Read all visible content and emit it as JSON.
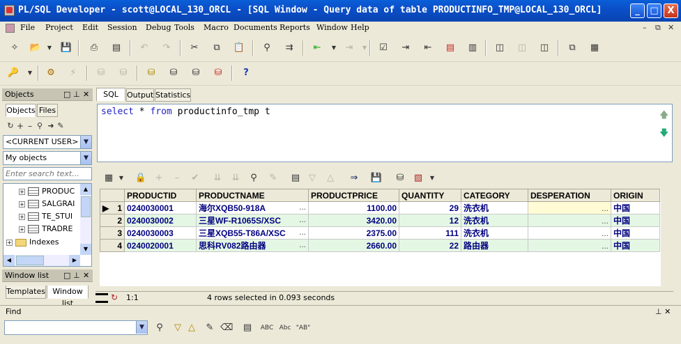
{
  "window": {
    "title": "PL/SQL Developer - scott@LOCAL_130_ORCL - [SQL Window - Query data of table PRODUCTINFO_TMP@LOCAL_130_ORCL]",
    "min": "_",
    "max": "□",
    "close": "X"
  },
  "menu": [
    "File",
    "Project",
    "Edit",
    "Session",
    "Debug",
    "Tools",
    "Macro",
    "Documents",
    "Reports",
    "Window",
    "Help"
  ],
  "objects_panel": {
    "title": "Objects",
    "tabs": [
      "Objects",
      "Files"
    ],
    "user_combo": "<CURRENT USER>",
    "filter_combo": "My objects",
    "search_placeholder": "Enter search text...",
    "tree": [
      "PRODUC",
      "SALGRAI",
      "TE_STUI",
      "TRADRE",
      "Indexes"
    ]
  },
  "window_list_panel": {
    "title": "Window list",
    "tabs": [
      "Templates",
      "Window list"
    ]
  },
  "editor": {
    "tabs": [
      "SQL",
      "Output",
      "Statistics"
    ],
    "sql": {
      "kw1": "select",
      "mid": " * ",
      "kw2": "from",
      "rest": " productinfo_tmp t"
    }
  },
  "grid": {
    "columns": [
      "",
      "PRODUCTID",
      "PRODUCTNAME",
      "PRODUCTPRICE",
      "QUANTITY",
      "CATEGORY",
      "DESPERATION",
      "ORIGIN"
    ],
    "rows": [
      {
        "n": "1",
        "id": "0240030001",
        "name": "海尔XQB50-918A",
        "price": "1100.00",
        "qty": "29",
        "cat": "洗衣机",
        "desp": "",
        "origin": "中国"
      },
      {
        "n": "2",
        "id": "0240030002",
        "name": "三星WF-R1065S/XSC",
        "price": "3420.00",
        "qty": "12",
        "cat": "洗衣机",
        "desp": "",
        "origin": "中国"
      },
      {
        "n": "3",
        "id": "0240030003",
        "name": "三星XQB55-T86A/XSC",
        "price": "2375.00",
        "qty": "111",
        "cat": "洗衣机",
        "desp": "",
        "origin": "中国"
      },
      {
        "n": "4",
        "id": "0240020001",
        "name": "思科RV082路由器",
        "price": "2660.00",
        "qty": "22",
        "cat": "路由器",
        "desp": "",
        "origin": "中国"
      }
    ],
    "ellipsis": "..."
  },
  "status": {
    "position": "1:1",
    "message": "4 rows selected in 0.093 seconds"
  },
  "find": {
    "title": "Find",
    "pin": "⊥ ✕"
  }
}
